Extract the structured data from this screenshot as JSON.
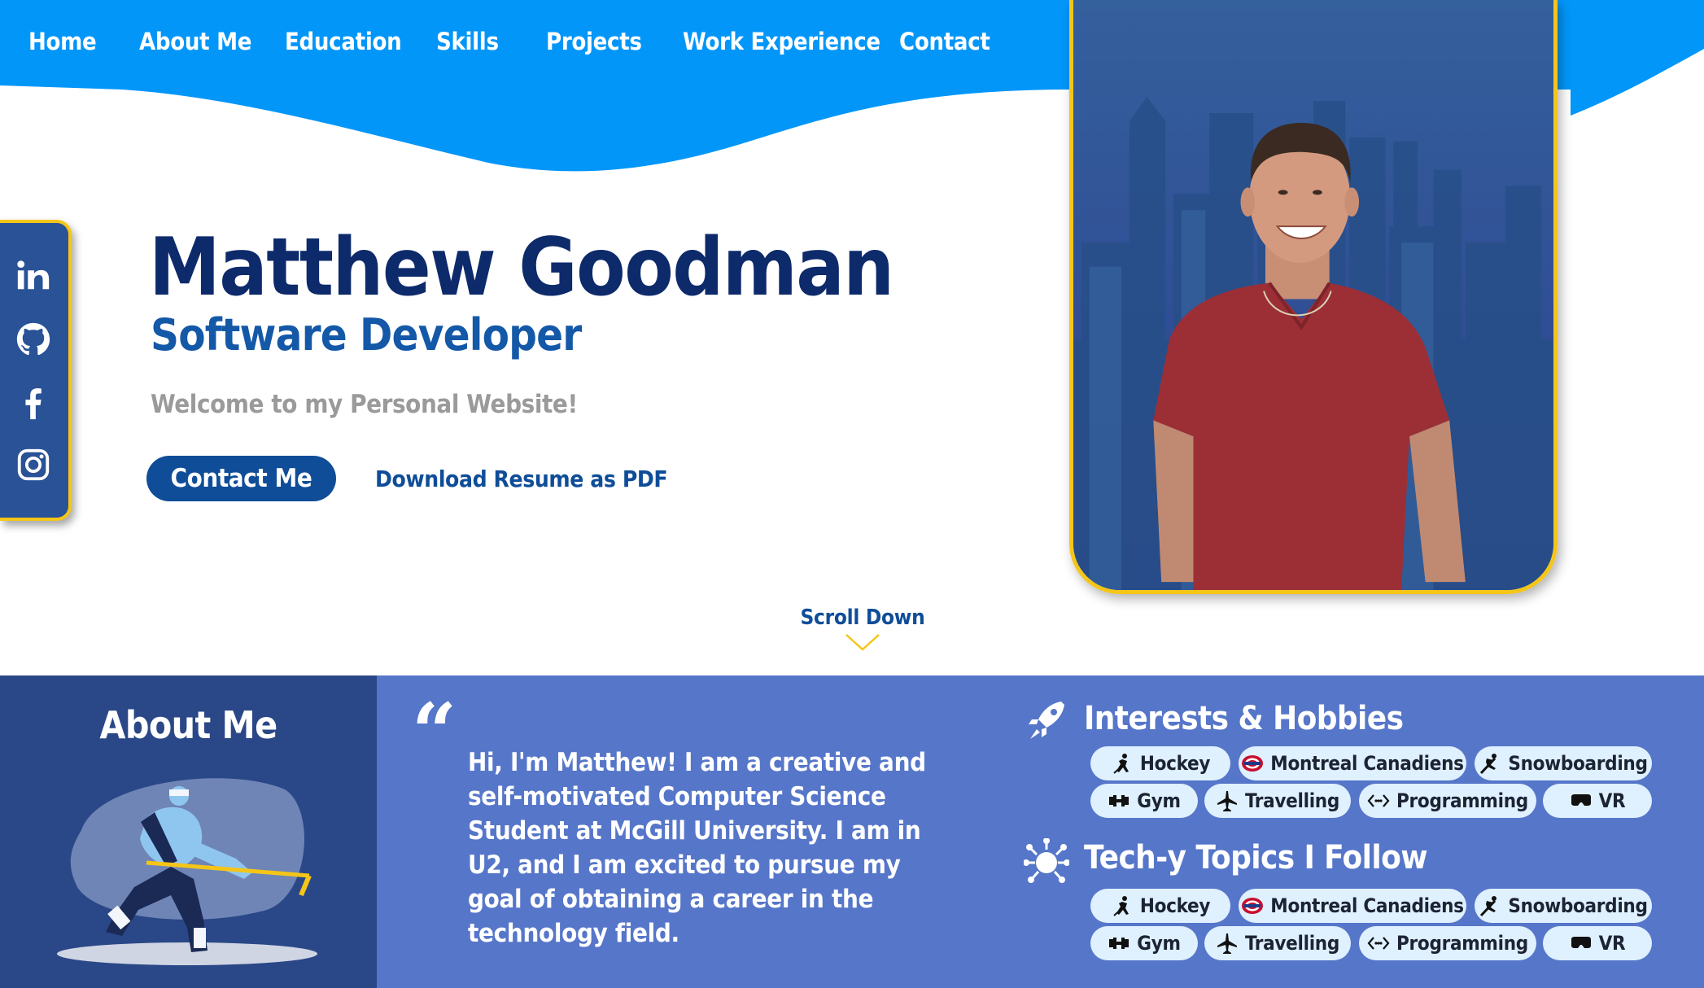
{
  "nav": {
    "items": [
      "Home",
      "About Me",
      "Education",
      "Skills",
      "Projects",
      "Work Experience",
      "Contact"
    ]
  },
  "social": {
    "icons": [
      "linkedin-icon",
      "github-icon",
      "facebook-icon",
      "instagram-icon"
    ]
  },
  "hero": {
    "name": "Matthew Goodman",
    "role": "Software Developer",
    "welcome": "Welcome to my Personal Website!",
    "contact_button": "Contact Me",
    "resume_link": "Download Resume as PDF",
    "scroll_label": "Scroll Down"
  },
  "about": {
    "title": "About Me",
    "quote_mark": "“",
    "text": "Hi, I'm Matthew! I am a creative and self-motivated Computer Science Student at McGill University. I am in U2, and I am excited to pursue my goal of obtaining a career in the technology field."
  },
  "interests": {
    "title": "Interests & Hobbies",
    "icon": "rocket-icon",
    "items": [
      {
        "label": "Hockey",
        "icon": "hockey-player-icon"
      },
      {
        "label": "Montreal Canadiens",
        "icon": "canadiens-logo-icon"
      },
      {
        "label": "Snowboarding",
        "icon": "snowboarder-icon"
      },
      {
        "label": "Gym",
        "icon": "dumbbell-icon"
      },
      {
        "label": "Travelling",
        "icon": "airplane-icon"
      },
      {
        "label": "Programming",
        "icon": "code-icon"
      },
      {
        "label": "VR",
        "icon": "vr-headset-icon"
      }
    ]
  },
  "tech": {
    "title": "Tech-y Topics I Follow",
    "icon": "tech-bug-icon",
    "items": [
      {
        "label": "Hockey",
        "icon": "hockey-player-icon"
      },
      {
        "label": "Montreal Canadiens",
        "icon": "canadiens-logo-icon"
      },
      {
        "label": "Snowboarding",
        "icon": "snowboarder-icon"
      },
      {
        "label": "Gym",
        "icon": "dumbbell-icon"
      },
      {
        "label": "Travelling",
        "icon": "airplane-icon"
      },
      {
        "label": "Programming",
        "icon": "code-icon"
      },
      {
        "label": "VR",
        "icon": "vr-headset-icon"
      }
    ]
  },
  "colors": {
    "nav_blue": "#0396f9",
    "navy": "#0d2a6b",
    "accent_yellow": "#f5c518",
    "about_dark": "#2a4787",
    "about_light": "#5676c9",
    "pill_bg": "#dff0ff"
  }
}
